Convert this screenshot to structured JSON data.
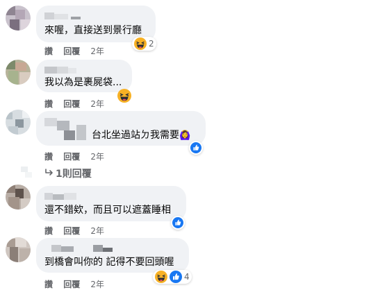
{
  "comments": [
    {
      "text": "來喔，直接送到景行廳",
      "actions": {
        "like": "讚",
        "reply": "回覆",
        "time": "2年"
      },
      "reaction": {
        "icon": "haha-icon",
        "count": "2"
      }
    },
    {
      "text": "我以為是裹屍袋...",
      "actions": {
        "like": "讚",
        "reply": "回覆",
        "time": "2年"
      },
      "reaction": {
        "icon": "haha-icon",
        "count": ""
      }
    },
    {
      "text": "台北坐過站ㄉ我需要",
      "emoji": "🙆‍♀️",
      "actions": {
        "like": "讚",
        "reply": "回覆",
        "time": "2年"
      },
      "reaction": {
        "icon": "like-icon",
        "count": ""
      },
      "replies_link": "1則回覆"
    },
    {
      "text": "還不錯欸，而且可以遮蓋睡相",
      "actions": {
        "like": "讚",
        "reply": "回覆",
        "time": "2年"
      },
      "reaction": {
        "icon": "like-icon",
        "count": ""
      }
    },
    {
      "text": "到橋會叫你的 記得不要回頭喔",
      "actions": {
        "like": "讚",
        "reply": "回覆",
        "time": "2年"
      },
      "reaction": {
        "icon": "haha-icon",
        "count": "4"
      }
    }
  ],
  "colors": {
    "bubble": "#f0f2f5",
    "meta": "#65676b",
    "like_blue": "#1877f2",
    "haha_yellow": "#f7b125"
  }
}
